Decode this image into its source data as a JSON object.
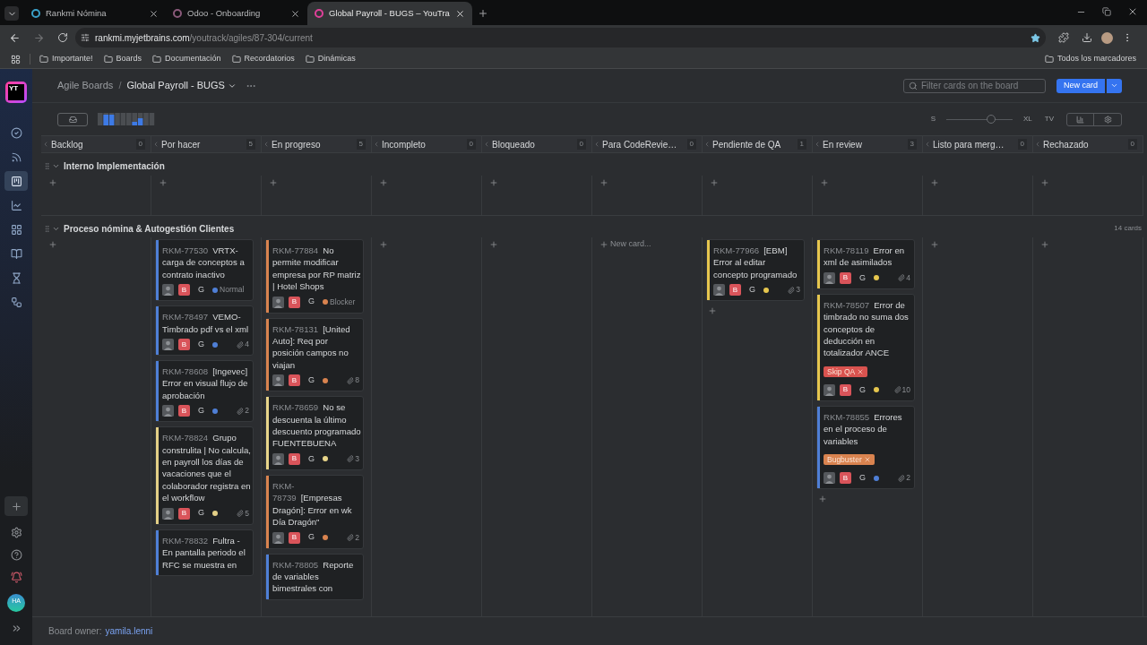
{
  "browser": {
    "tabs": [
      {
        "title": "Rankmi Nómina",
        "selected": false,
        "color": "#3aa0c8"
      },
      {
        "title": "Odoo - Onboarding",
        "selected": false,
        "color": "#8a5a7a"
      },
      {
        "title": "Global Payroll - BUGS – YouTra",
        "selected": true,
        "color": "#e0409a"
      }
    ],
    "url": {
      "host": "rankmi.myjetbrains.com",
      "path": "/youtrack/agiles/87-304/current"
    },
    "bookmarks": [
      "Importante!",
      "Boards",
      "Documentación",
      "Recordatorios",
      "Dinámicas"
    ],
    "all_bookmarks": "Todos los marcadores"
  },
  "sidebar": {
    "logo": "YT",
    "items": [
      {
        "kind": "check",
        "selected": false
      },
      {
        "kind": "signal",
        "selected": false
      },
      {
        "kind": "board",
        "selected": true
      },
      {
        "kind": "chart",
        "selected": false
      },
      {
        "kind": "grid",
        "selected": false
      },
      {
        "kind": "book",
        "selected": false
      },
      {
        "kind": "hourglass",
        "selected": false
      },
      {
        "kind": "steps",
        "selected": false
      }
    ],
    "avatar": "HA"
  },
  "breadcrumbs": {
    "parent": "Agile Boards",
    "separator": "/",
    "current": "Global Payroll - BUGS"
  },
  "search": {
    "placeholder": "Filter cards on the board"
  },
  "new_card_button": "New card",
  "size": {
    "min": "S",
    "max": "XL",
    "level": 0.67,
    "tv": "TV"
  },
  "columns": [
    {
      "name": "Backlog",
      "count": "0"
    },
    {
      "name": "Por hacer",
      "count": "5"
    },
    {
      "name": "En progreso",
      "count": "5"
    },
    {
      "name": "Incompleto",
      "count": "0"
    },
    {
      "name": "Bloqueado",
      "count": "0"
    },
    {
      "name": "Para CodeRevie…",
      "count": "0"
    },
    {
      "name": "Pendiente de QA",
      "count": "1"
    },
    {
      "name": "En review",
      "count": "3"
    },
    {
      "name": "Listo para merg…",
      "count": "0"
    },
    {
      "name": "Rechazado",
      "count": "0"
    }
  ],
  "swimlanes": [
    {
      "title": "Interno Implementación",
      "expanded": true,
      "cells": [
        {
          "kind": "empty"
        },
        {
          "kind": "empty"
        },
        {
          "kind": "empty"
        },
        {
          "kind": "empty"
        },
        {
          "kind": "empty"
        },
        {
          "kind": "empty"
        },
        {
          "kind": "empty"
        },
        {
          "kind": "empty"
        },
        {
          "kind": "empty"
        },
        {
          "kind": "empty"
        }
      ]
    },
    {
      "title": "Proceso nómina & Autogestión Clientes",
      "expanded": true,
      "count": "14 cards",
      "cells": [
        {
          "kind": "empty"
        },
        {
          "kind": "cards",
          "cards": [
            {
              "id": "RKM-77530",
              "title": "VRTX-carga de conceptos a contrato inactivo",
              "color": "#4f7fd6",
              "badge": "B",
              "field": "G",
              "priority": "Normal"
            },
            {
              "id": "RKM-78497",
              "title": "VEMO-Timbrado pdf vs el xml",
              "color": "#4f7fd6",
              "badge": "B",
              "field": "G",
              "attachments": "4"
            },
            {
              "id": "RKM-78608",
              "title": "[Ingevec] Error en visual flujo de aprobación",
              "color": "#4f7fd6",
              "badge": "B",
              "field": "G",
              "attachments": "2"
            },
            {
              "id": "RKM-78824",
              "title": "Grupo construlita | No calcula, en payroll los días de vacaciones que el colaborador registra en el workflow",
              "color": "#e3cf86",
              "badge": "B",
              "field": "G",
              "attachments": "5"
            },
            {
              "id": "RKM-78832",
              "title": "Fultra - En pantalla periodo el RFC se muestra en",
              "color": "#4f7fd6"
            }
          ]
        },
        {
          "kind": "cards",
          "cards": [
            {
              "id": "RKM-77884",
              "title": "No permite modificar empresa por RP matriz | Hotel Shops",
              "color": "#d9834f",
              "badge": "B",
              "field": "G",
              "priority": "Blocker"
            },
            {
              "id": "RKM-78131",
              "title": "[United Auto]: Req por posición campos no viajan",
              "color": "#d9834f",
              "badge": "B",
              "field": "G",
              "attachments": "8"
            },
            {
              "id": "RKM-78659",
              "title": "No se descuenta la último descuento programado FUENTEBUENA",
              "color": "#e8d58a",
              "badge": "B",
              "field": "G",
              "attachments": "3"
            },
            {
              "id": "RKM-78739",
              "title": "[Empresas Dragón]: Error en wk Día Dragón\"",
              "color": "#d9834f",
              "badge": "B",
              "field": "G",
              "attachments": "2"
            },
            {
              "id": "RKM-78805",
              "title": "Reporte de variables bimestrales con",
              "color": "#4f7fd6"
            }
          ]
        },
        {
          "kind": "empty"
        },
        {
          "kind": "empty"
        },
        {
          "kind": "empty",
          "add_label": "New card..."
        },
        {
          "kind": "cards_add",
          "cards": [
            {
              "id": "RKM-77966",
              "title": "[EBM] Error al editar concepto programado",
              "color": "#e6c64e",
              "badge": "B",
              "field": "G",
              "attachments": "3"
            }
          ]
        },
        {
          "kind": "cards_add",
          "cards": [
            {
              "id": "RKM-78119",
              "title": "Error en xml de asimilados",
              "color": "#e6c64e",
              "badge": "B",
              "field": "G",
              "attachments": "4"
            },
            {
              "id": "RKM-78507",
              "title": "Error de timbrado no suma dos conceptos de deducción en totalizador ANCE",
              "color": "#e6c64e",
              "badge": "B",
              "field": "G",
              "attachments": "10",
              "tags": [
                {
                  "text": "Skip QA",
                  "color": "#d9534f"
                }
              ]
            },
            {
              "id": "RKM-78855",
              "title": "Errores en el proceso de variables",
              "color": "#4f7fd6",
              "badge": "B",
              "field": "G",
              "attachments": "2",
              "tags": [
                {
                  "text": "Bugbuster",
                  "color": "#d9834f"
                }
              ]
            }
          ]
        },
        {
          "kind": "empty"
        },
        {
          "kind": "empty"
        }
      ]
    }
  ],
  "footer": {
    "label": "Board owner:",
    "owner": "yamila.lenni"
  }
}
